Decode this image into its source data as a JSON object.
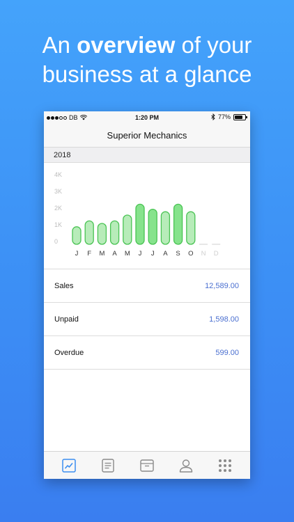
{
  "headline": {
    "part1": "An ",
    "bold": "overview",
    "part2": " of your",
    "line2": "business at a glance"
  },
  "statusbar": {
    "carrier": "DB",
    "time": "1:20 PM",
    "battery": "77%",
    "signal_bars_filled": 3,
    "signal_bars_total": 5
  },
  "navbar": {
    "title": "Superior Mechanics"
  },
  "year": "2018",
  "chart_data": {
    "type": "bar",
    "categories": [
      "J",
      "F",
      "M",
      "A",
      "M",
      "J",
      "J",
      "A",
      "S",
      "O",
      "N",
      "D"
    ],
    "values": [
      1050,
      1400,
      1250,
      1400,
      1750,
      2400,
      2100,
      1950,
      2400,
      1950,
      0,
      0
    ],
    "yticks": [
      "0",
      "1K",
      "2K",
      "3K",
      "4K"
    ],
    "ylim": [
      0,
      4000
    ],
    "grid": false,
    "colors": {
      "fill": "#b7ecb9",
      "fill_strong": "#86e38c",
      "stroke": "#49c353",
      "muted": "#cfcfcf",
      "tick": "#bdbdbd",
      "month": "#333333"
    }
  },
  "summary": [
    {
      "label": "Sales",
      "value": "12,589.00"
    },
    {
      "label": "Unpaid",
      "value": "1,598.00"
    },
    {
      "label": "Overdue",
      "value": "599.00"
    }
  ],
  "tabbar": {
    "items": [
      {
        "icon": "chart-icon",
        "active": true
      },
      {
        "icon": "document-icon",
        "active": false
      },
      {
        "icon": "archive-box-icon",
        "active": false
      },
      {
        "icon": "person-icon",
        "active": false
      },
      {
        "icon": "grid-menu-icon",
        "active": false
      }
    ],
    "active_color": "#3b8ef0",
    "inactive_color": "#8a8a8a"
  }
}
